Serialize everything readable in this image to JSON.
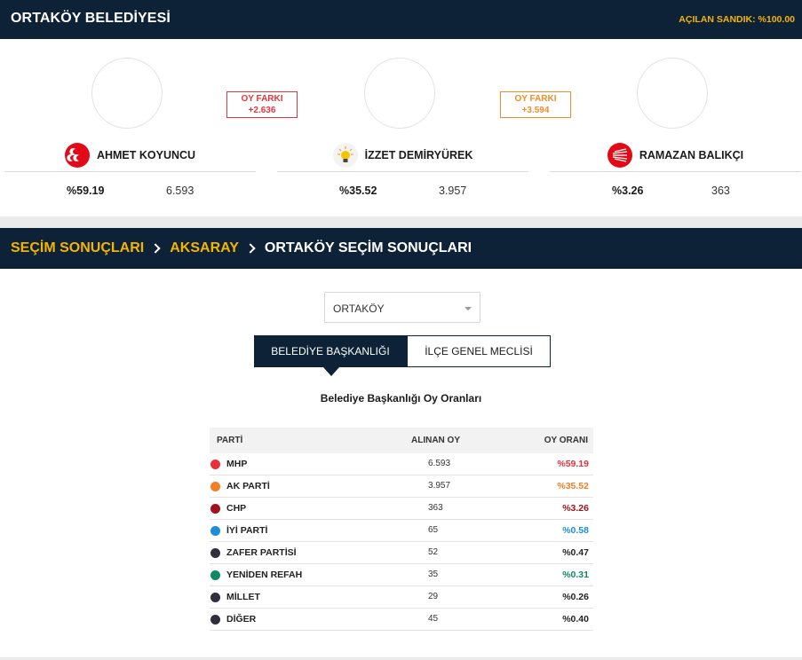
{
  "header": {
    "title": "ORTAKÖY BELEDİYESİ",
    "opened_boxes": "AÇILAN SANDIK: %100.00"
  },
  "candidates": [
    {
      "name": "AHMET KOYUNCU",
      "party_logo": "mhp-logo",
      "percent": "%59.19",
      "votes": "6.593"
    },
    {
      "name": "İZZET DEMİRYÜREK",
      "party_logo": "ak-parti-logo",
      "percent": "%35.52",
      "votes": "3.957"
    },
    {
      "name": "RAMAZAN BALIKÇI",
      "party_logo": "chp-logo",
      "percent": "%3.26",
      "votes": "363"
    }
  ],
  "differences": [
    {
      "label": "OY FARKI",
      "value": "+2.636",
      "color": "#e0383e"
    },
    {
      "label": "OY FARKI",
      "value": "+3.594",
      "color": "#f28c28"
    }
  ],
  "breadcrumb": {
    "item1": "SEÇİM SONUÇLARI",
    "item2": "AKSARAY",
    "item3": "ORTAKÖY SEÇİM SONUÇLARI"
  },
  "district_select": {
    "value": "ORTAKÖY"
  },
  "tabs": {
    "active": "BELEDİYE BAŞKANLIĞI",
    "inactive": "İLÇE GENEL MECLİSİ"
  },
  "table_title": "Belediye Başkanlığı Oy Oranları",
  "table": {
    "headers": {
      "party": "PARTİ",
      "votes": "ALINAN OY",
      "ratio": "OY ORANI"
    },
    "rows": [
      {
        "party": "MHP",
        "votes": "6.593",
        "ratio": "%59.19",
        "color": "#e8303a"
      },
      {
        "party": "AK PARTİ",
        "votes": "3.957",
        "ratio": "%35.52",
        "color": "#f57f25"
      },
      {
        "party": "CHP",
        "votes": "363",
        "ratio": "%3.26",
        "color": "#a1131a"
      },
      {
        "party": "İYİ PARTİ",
        "votes": "65",
        "ratio": "%0.58",
        "color": "#1f8dd6"
      },
      {
        "party": "ZAFER PARTİSİ",
        "votes": "52",
        "ratio": "%0.47",
        "color": "#2f2f3d"
      },
      {
        "party": "YENİDEN REFAH",
        "votes": "35",
        "ratio": "%0.31",
        "color": "#0e8a5f"
      },
      {
        "party": "MİLLET",
        "votes": "29",
        "ratio": "%0.26",
        "color": "#2f2f3d"
      },
      {
        "party": "DİĞER",
        "votes": "45",
        "ratio": "%0.40",
        "color": "#2f2f3d"
      }
    ]
  }
}
